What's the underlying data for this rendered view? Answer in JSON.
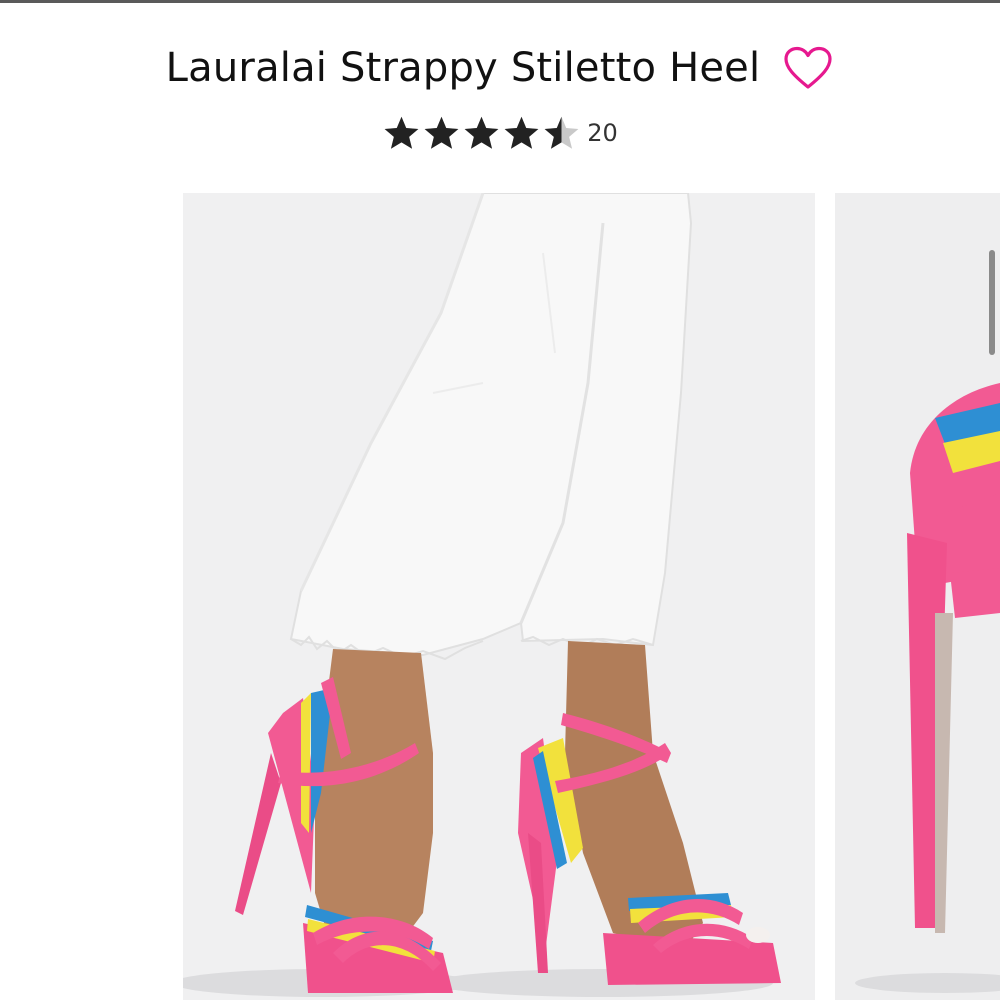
{
  "product": {
    "title": "Lauralai Strappy Stiletto Heel",
    "favorite_icon": "heart-outline-icon",
    "rating": {
      "stars": 4.5,
      "max_stars": 5,
      "review_count": "20",
      "star_color": "#222222"
    }
  },
  "gallery": {
    "images": [
      {
        "subject": "model-wearing-pink-strappy-heels"
      },
      {
        "subject": "pink-heel-side-view"
      }
    ],
    "current_index": 0
  },
  "colors": {
    "accent": "#e6198f",
    "shoe_pink": "#f25a93",
    "strap_yellow": "#f2e13c",
    "strap_blue": "#2e8fd3"
  }
}
